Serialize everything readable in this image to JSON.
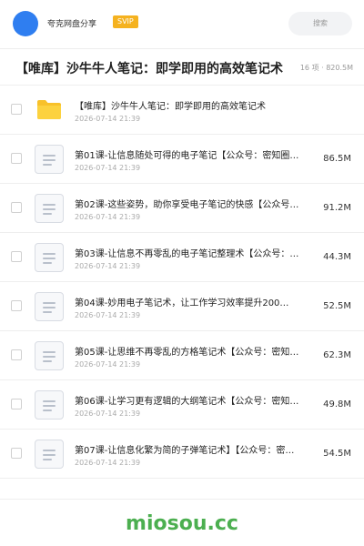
{
  "header": {
    "username": "夸克网盘分享",
    "vip_badge": "SVIP",
    "search_placeholder": "搜索",
    "avatar_color": "#2f7ef0",
    "vip_color": "#f5b21f"
  },
  "title_row": {
    "title": "【唯库】沙牛牛人笔记：即学即用的高效笔记术",
    "meta": "16 项 · 820.5M"
  },
  "files": [
    {
      "icon": "folder-icon",
      "name": "【唯库】沙牛牛人笔记：即学即用的高效笔记术",
      "date": "2026-07-14 21:39",
      "size": ""
    },
    {
      "icon": "document-icon",
      "name": "第01课-让信息随处可得的电子笔记【公众号：密知圈…",
      "date": "2026-07-14 21:39",
      "size": "86.5M"
    },
    {
      "icon": "document-icon",
      "name": "第02课-这些姿势，助你享受电子笔记的快感【公众号…",
      "date": "2026-07-14 21:39",
      "size": "91.2M"
    },
    {
      "icon": "document-icon",
      "name": "第03课-让信息不再零乱的电子笔记整理术【公众号：…",
      "date": "2026-07-14 21:39",
      "size": "44.3M"
    },
    {
      "icon": "document-icon",
      "name": "第04课-妙用电子笔记术，让工作学习效率提升200…",
      "date": "2026-07-14 21:39",
      "size": "52.5M"
    },
    {
      "icon": "document-icon",
      "name": "第05课-让思维不再零乱的方格笔记术【公众号：密知…",
      "date": "2026-07-14 21:39",
      "size": "62.3M"
    },
    {
      "icon": "document-icon",
      "name": "第06课-让学习更有逻辑的大纲笔记术【公众号：密知…",
      "date": "2026-07-14 21:39",
      "size": "49.8M"
    },
    {
      "icon": "document-icon",
      "name": "第07课-让信息化繁为简的子弹笔记术】【公众号：密…",
      "date": "2026-07-14 21:39",
      "size": "54.5M"
    }
  ],
  "footer": {
    "watermark": "miosou.cc",
    "watermark_color": "#4caf50"
  }
}
